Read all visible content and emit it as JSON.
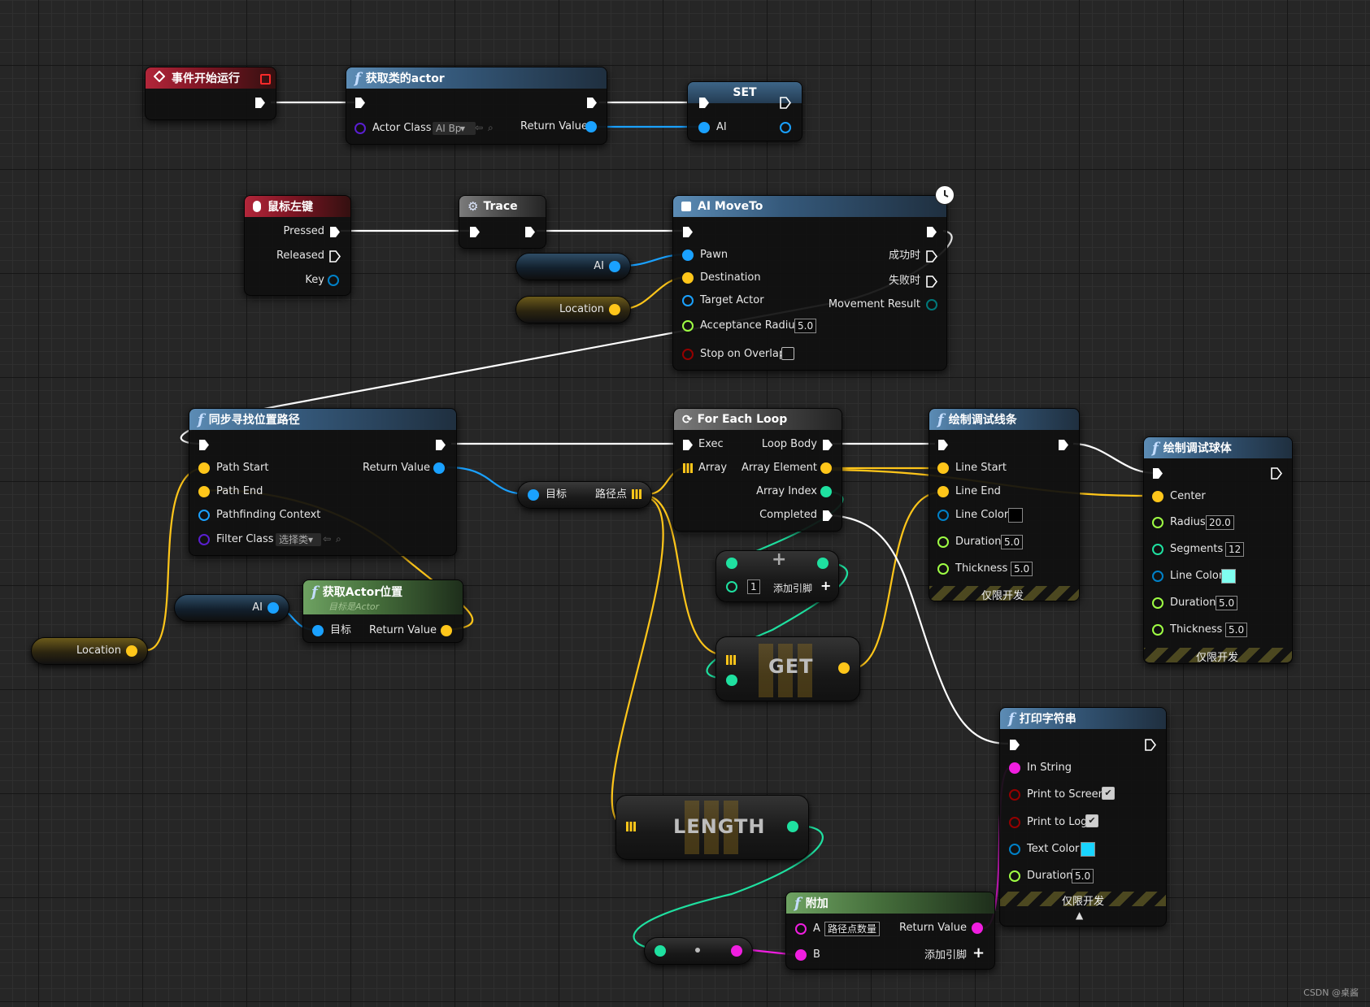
{
  "nodes": {
    "begin_play": {
      "title": "事件开始运行"
    },
    "get_actor": {
      "title": "获取类的actor",
      "actor_class_label": "Actor Class",
      "actor_class_value": "AI Bp",
      "return_label": "Return Value"
    },
    "set": {
      "title": "SET",
      "ai_label": "AI"
    },
    "mouse": {
      "title": "鼠标左键",
      "pressed": "Pressed",
      "released": "Released",
      "key": "Key"
    },
    "trace": {
      "title": "Trace"
    },
    "ai_moveto": {
      "title": "AI MoveTo",
      "pawn": "Pawn",
      "destination": "Destination",
      "target_actor": "Target Actor",
      "acceptance_radius": "Acceptance Radius",
      "acceptance_value": "5.0",
      "stop_on_overlap": "Stop on Overlap",
      "on_success": "成功时",
      "on_fail": "失败时",
      "movement_result": "Movement Result"
    },
    "find_path": {
      "title": "同步寻找位置路径",
      "path_start": "Path Start",
      "path_end": "Path End",
      "pathfinding_context": "Pathfinding Context",
      "filter_class": "Filter Class",
      "filter_value": "选择类",
      "return_label": "Return Value"
    },
    "for_each": {
      "title": "For Each Loop",
      "exec": "Exec",
      "array": "Array",
      "loop_body": "Loop Body",
      "array_element": "Array Element",
      "array_index": "Array Index",
      "completed": "Completed"
    },
    "draw_line": {
      "title": "绘制调试线条",
      "line_start": "Line Start",
      "line_end": "Line End",
      "line_color": "Line Color",
      "duration": "Duration",
      "duration_value": "5.0",
      "thickness": "Thickness",
      "thickness_value": "5.0",
      "dev_only": "仅限开发"
    },
    "draw_sphere": {
      "title": "绘制调试球体",
      "center": "Center",
      "radius": "Radius",
      "radius_value": "20.0",
      "segments": "Segments",
      "segments_value": "12",
      "line_color": "Line Color",
      "duration": "Duration",
      "duration_value": "5.0",
      "thickness": "Thickness",
      "thickness_value": "5.0",
      "dev_only": "仅限开发"
    },
    "get_actor_location": {
      "title": "获取Actor位置",
      "subtitle": "目标是Actor",
      "target": "目标",
      "return_label": "Return Value"
    },
    "break_path": {
      "target": "目标",
      "path_points": "路径点"
    },
    "add": {
      "value": "1",
      "add_pin": "添加引脚"
    },
    "get": {
      "label": "GET"
    },
    "length": {
      "label": "LENGTH"
    },
    "print_string": {
      "title": "打印字符串",
      "in_string": "In String",
      "print_to_screen": "Print to Screen",
      "print_to_log": "Print to Log",
      "text_color": "Text Color",
      "duration": "Duration",
      "duration_value": "5.0",
      "dev_only": "仅限开发"
    },
    "append": {
      "title": "附加",
      "a_label": "A",
      "a_value": "路径点数量",
      "b_label": "B",
      "return_label": "Return Value",
      "add_pin": "添加引脚"
    }
  },
  "variables": {
    "ai_1": "AI",
    "location_1": "Location",
    "ai_2": "AI",
    "location_2": "Location"
  },
  "colors": {
    "exec": "#ffffff",
    "object": "#1aa1ff",
    "vector": "#ffc61a",
    "integer": "#1fe0a0",
    "float": "#9fff44",
    "string": "#f01ee0",
    "bool": "#950000",
    "struct": "#0081c8",
    "line_color_swatch": "#000000",
    "sphere_color_swatch": "#7ffff0",
    "text_color_swatch": "#19d4ff"
  },
  "watermark": "CSDN @桌酱"
}
